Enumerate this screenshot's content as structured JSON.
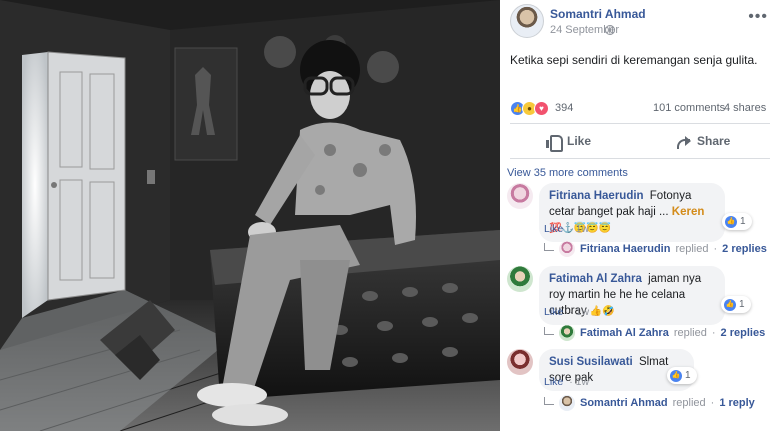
{
  "post": {
    "author": "Somantri Ahmad",
    "date": "24 September",
    "text": "Ketika sepi sendiri di keremangan senja gulita.",
    "reaction_count": "394",
    "comments_count": "101 comments",
    "shares_count": "4 shares",
    "like_label": "Like",
    "share_label": "Share"
  },
  "view_more": "View 35 more comments",
  "comments": [
    {
      "name": "Fitriana Haerudin",
      "text_line1": "Fotonya cetar banget",
      "text_line2": "pak haji ...",
      "highlight": "Keren",
      "emoji": "💯⚓😇😇😇",
      "likes": "1",
      "like_action": "Like",
      "time": "1w",
      "reply_name": "Fitriana Haerudin",
      "reply_verb": "replied",
      "reply_link": "2 replies"
    },
    {
      "name": "Fatimah Al Zahra",
      "text_line1": "jaman nya roy martin he",
      "text_line2": "he he celana cutbray",
      "emoji": "👍🤣",
      "likes": "1",
      "like_action": "Like",
      "time": "1w",
      "reply_name": "Fatimah Al Zahra",
      "reply_verb": "replied",
      "reply_link": "2 replies"
    },
    {
      "name": "Susi Susilawati",
      "text_line1": "Slmat sore pak",
      "likes": "1",
      "like_action": "Like",
      "time": "1w",
      "reply_name": "Somantri Ahmad",
      "reply_verb": "replied",
      "reply_link": "1 reply"
    }
  ],
  "colors": {
    "link": "#385898",
    "muted": "#90949c",
    "bubble": "#f2f3f5",
    "like_blue": "#4a83f0"
  }
}
